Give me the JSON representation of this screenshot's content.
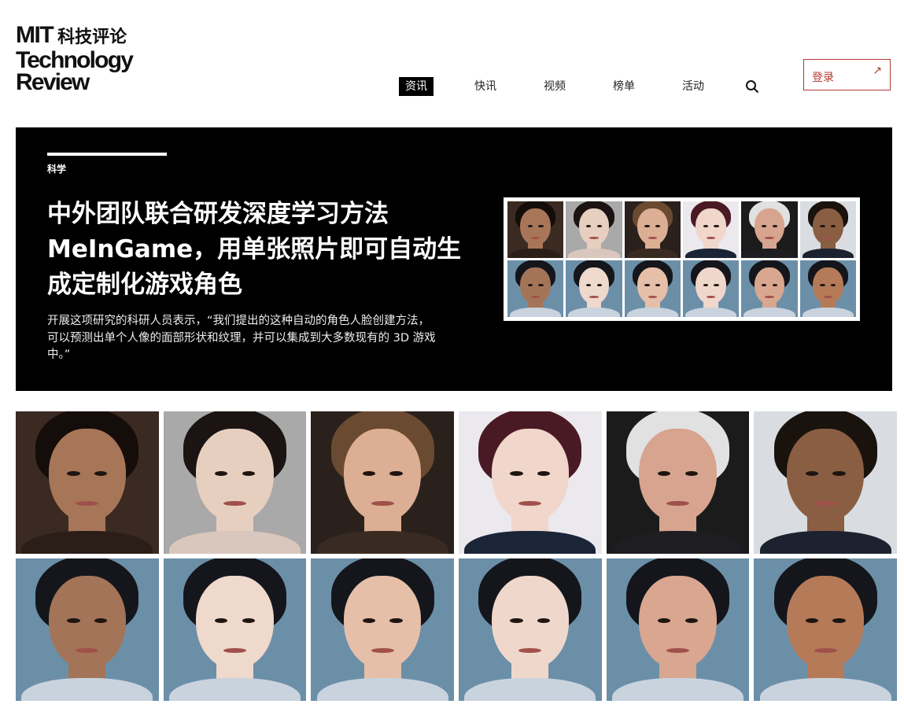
{
  "logo": {
    "line1": "MIT",
    "cn": "科技评论",
    "line2": "Technology",
    "line3": "Review"
  },
  "nav": {
    "items": [
      "资讯",
      "快讯",
      "视频",
      "榜单",
      "活动"
    ],
    "active_index": 0
  },
  "login": {
    "label": "登录",
    "arrow": "↗"
  },
  "hero": {
    "category": "科学",
    "title": "中外团队联合研发深度学习方法MeInGame，用单张照片即可自动生成定制化游戏角色",
    "description": "开展这项研究的科研人员表示，“我们提出的这种自动的角色人脸创建方法，可以预测出单个人像的面部形状和纹理，并可以集成到大多数现有的 3D 游戏中。”"
  },
  "colors": {
    "accent": "#b33a30",
    "hero_bg": "#000000"
  }
}
